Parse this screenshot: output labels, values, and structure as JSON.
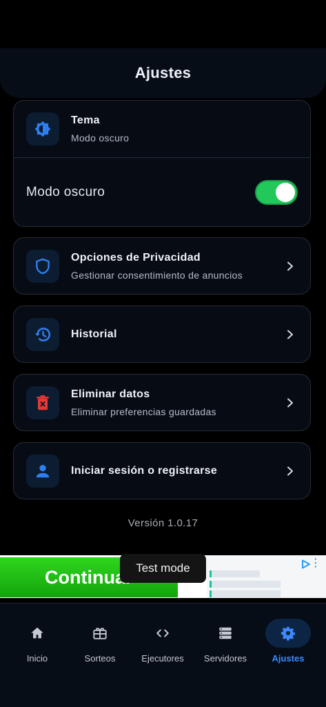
{
  "header": {
    "title": "Ajustes"
  },
  "theme_card": {
    "title": "Tema",
    "subtitle": "Modo oscuro",
    "toggle_label": "Modo oscuro",
    "toggle_on": true
  },
  "settings_items": [
    {
      "title": "Opciones de Privacidad",
      "subtitle": "Gestionar consentimiento de anuncios",
      "icon": "shield-icon"
    },
    {
      "title": "Historial",
      "icon": "history-icon"
    },
    {
      "title": "Eliminar datos",
      "subtitle": "Eliminar preferencias guardadas",
      "icon": "trash-icon"
    },
    {
      "title": "Iniciar sesión o registrarse",
      "icon": "user-icon"
    }
  ],
  "version": "Versión 1.0.17",
  "ad": {
    "cta": "Continuar",
    "tooltip": "Test mode"
  },
  "bottom_nav": {
    "items": [
      {
        "label": "Inicio",
        "icon": "home-icon"
      },
      {
        "label": "Sorteos",
        "icon": "gift-icon"
      },
      {
        "label": "Ejecutores",
        "icon": "code-icon"
      },
      {
        "label": "Servidores",
        "icon": "server-icon"
      },
      {
        "label": "Ajustes",
        "icon": "gear-icon",
        "active": true
      }
    ]
  },
  "colors": {
    "accent": "#3b8bff",
    "toggle_on": "#22c85a",
    "danger": "#e53935",
    "card_bg": "#060b14"
  }
}
